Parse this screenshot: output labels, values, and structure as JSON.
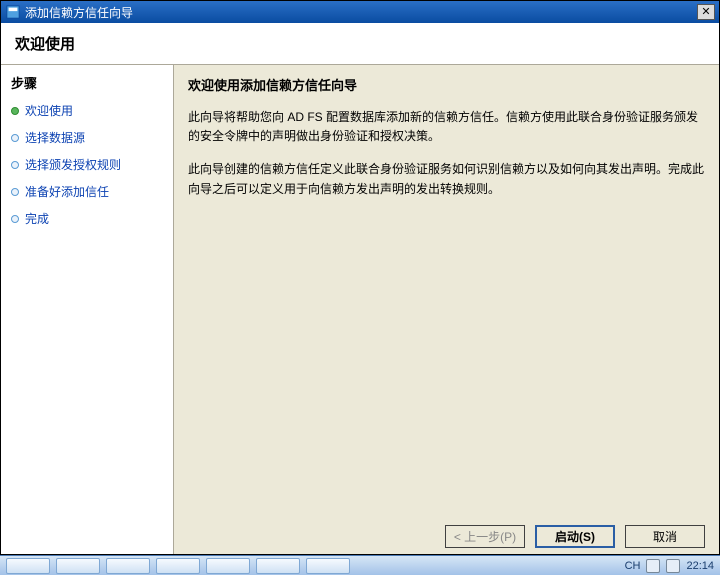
{
  "title": "添加信赖方信任向导",
  "header": "欢迎使用",
  "sidebar": {
    "title": "步骤",
    "steps": [
      {
        "label": "欢迎使用",
        "active": true
      },
      {
        "label": "选择数据源",
        "active": false
      },
      {
        "label": "选择颁发授权规则",
        "active": false
      },
      {
        "label": "准备好添加信任",
        "active": false
      },
      {
        "label": "完成",
        "active": false
      }
    ]
  },
  "content": {
    "title": "欢迎使用添加信赖方信任向导",
    "para1": "此向导将帮助您向 AD FS 配置数据库添加新的信赖方信任。信赖方使用此联合身份验证服务颁发的安全令牌中的声明做出身份验证和授权决策。",
    "para2": "此向导创建的信赖方信任定义此联合身份验证服务如何识别信赖方以及如何向其发出声明。完成此向导之后可以定义用于向信赖方发出声明的发出转换规则。"
  },
  "buttons": {
    "prev": "< 上一步(P)",
    "start": "启动(S)",
    "cancel": "取消"
  },
  "tray": {
    "lang": "CH",
    "time": "22:14"
  }
}
